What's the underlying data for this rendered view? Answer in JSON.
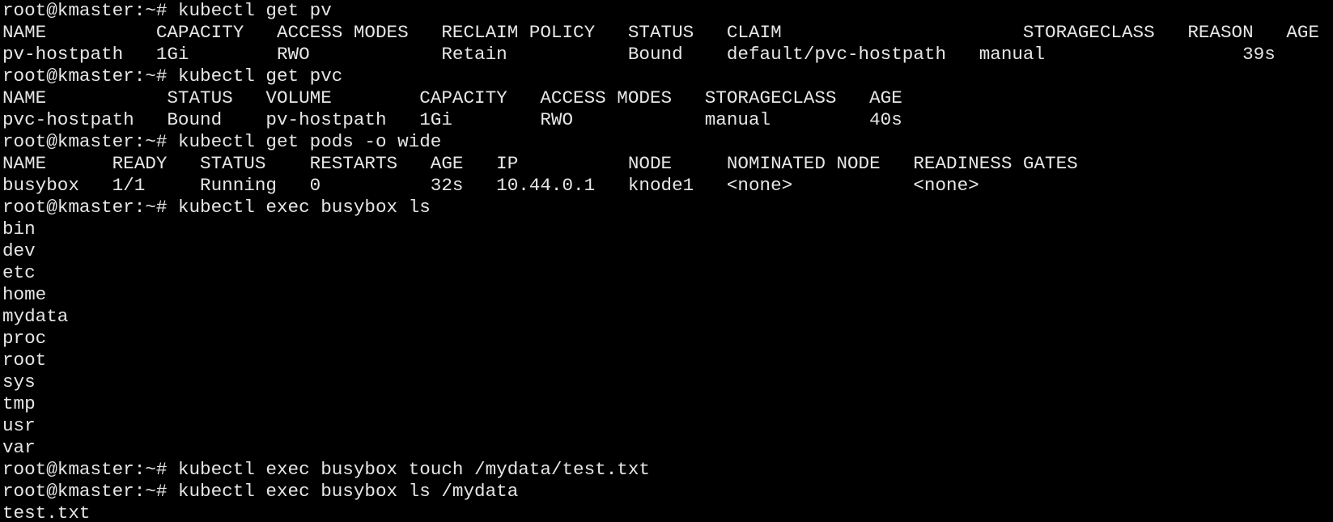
{
  "terminal": {
    "lines": [
      "root@kmaster:~# kubectl get pv",
      "NAME          CAPACITY   ACCESS MODES   RECLAIM POLICY   STATUS   CLAIM                      STORAGECLASS   REASON   AGE",
      "pv-hostpath   1Gi        RWO            Retain           Bound    default/pvc-hostpath   manual                  39s",
      "root@kmaster:~# kubectl get pvc",
      "NAME           STATUS   VOLUME        CAPACITY   ACCESS MODES   STORAGECLASS   AGE",
      "pvc-hostpath   Bound    pv-hostpath   1Gi        RWO            manual         40s",
      "root@kmaster:~# kubectl get pods -o wide",
      "NAME      READY   STATUS    RESTARTS   AGE   IP          NODE     NOMINATED NODE   READINESS GATES",
      "busybox   1/1     Running   0          32s   10.44.0.1   knode1   <none>           <none>",
      "root@kmaster:~# kubectl exec busybox ls",
      "bin",
      "dev",
      "etc",
      "home",
      "mydata",
      "proc",
      "root",
      "sys",
      "tmp",
      "usr",
      "var",
      "root@kmaster:~# kubectl exec busybox touch /mydata/test.txt",
      "root@kmaster:~# kubectl exec busybox ls /mydata",
      "test.txt"
    ]
  }
}
